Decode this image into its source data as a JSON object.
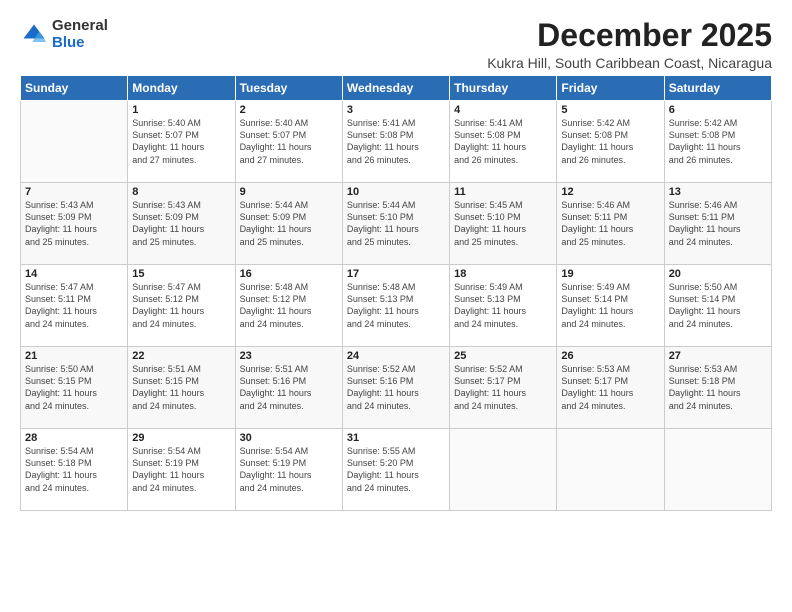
{
  "logo": {
    "general": "General",
    "blue": "Blue"
  },
  "title": "December 2025",
  "subtitle": "Kukra Hill, South Caribbean Coast, Nicaragua",
  "headers": [
    "Sunday",
    "Monday",
    "Tuesday",
    "Wednesday",
    "Thursday",
    "Friday",
    "Saturday"
  ],
  "weeks": [
    [
      {
        "day": "",
        "info": ""
      },
      {
        "day": "1",
        "info": "Sunrise: 5:40 AM\nSunset: 5:07 PM\nDaylight: 11 hours\nand 27 minutes."
      },
      {
        "day": "2",
        "info": "Sunrise: 5:40 AM\nSunset: 5:07 PM\nDaylight: 11 hours\nand 27 minutes."
      },
      {
        "day": "3",
        "info": "Sunrise: 5:41 AM\nSunset: 5:08 PM\nDaylight: 11 hours\nand 26 minutes."
      },
      {
        "day": "4",
        "info": "Sunrise: 5:41 AM\nSunset: 5:08 PM\nDaylight: 11 hours\nand 26 minutes."
      },
      {
        "day": "5",
        "info": "Sunrise: 5:42 AM\nSunset: 5:08 PM\nDaylight: 11 hours\nand 26 minutes."
      },
      {
        "day": "6",
        "info": "Sunrise: 5:42 AM\nSunset: 5:08 PM\nDaylight: 11 hours\nand 26 minutes."
      }
    ],
    [
      {
        "day": "7",
        "info": "Sunrise: 5:43 AM\nSunset: 5:09 PM\nDaylight: 11 hours\nand 25 minutes."
      },
      {
        "day": "8",
        "info": "Sunrise: 5:43 AM\nSunset: 5:09 PM\nDaylight: 11 hours\nand 25 minutes."
      },
      {
        "day": "9",
        "info": "Sunrise: 5:44 AM\nSunset: 5:09 PM\nDaylight: 11 hours\nand 25 minutes."
      },
      {
        "day": "10",
        "info": "Sunrise: 5:44 AM\nSunset: 5:10 PM\nDaylight: 11 hours\nand 25 minutes."
      },
      {
        "day": "11",
        "info": "Sunrise: 5:45 AM\nSunset: 5:10 PM\nDaylight: 11 hours\nand 25 minutes."
      },
      {
        "day": "12",
        "info": "Sunrise: 5:46 AM\nSunset: 5:11 PM\nDaylight: 11 hours\nand 25 minutes."
      },
      {
        "day": "13",
        "info": "Sunrise: 5:46 AM\nSunset: 5:11 PM\nDaylight: 11 hours\nand 24 minutes."
      }
    ],
    [
      {
        "day": "14",
        "info": "Sunrise: 5:47 AM\nSunset: 5:11 PM\nDaylight: 11 hours\nand 24 minutes."
      },
      {
        "day": "15",
        "info": "Sunrise: 5:47 AM\nSunset: 5:12 PM\nDaylight: 11 hours\nand 24 minutes."
      },
      {
        "day": "16",
        "info": "Sunrise: 5:48 AM\nSunset: 5:12 PM\nDaylight: 11 hours\nand 24 minutes."
      },
      {
        "day": "17",
        "info": "Sunrise: 5:48 AM\nSunset: 5:13 PM\nDaylight: 11 hours\nand 24 minutes."
      },
      {
        "day": "18",
        "info": "Sunrise: 5:49 AM\nSunset: 5:13 PM\nDaylight: 11 hours\nand 24 minutes."
      },
      {
        "day": "19",
        "info": "Sunrise: 5:49 AM\nSunset: 5:14 PM\nDaylight: 11 hours\nand 24 minutes."
      },
      {
        "day": "20",
        "info": "Sunrise: 5:50 AM\nSunset: 5:14 PM\nDaylight: 11 hours\nand 24 minutes."
      }
    ],
    [
      {
        "day": "21",
        "info": "Sunrise: 5:50 AM\nSunset: 5:15 PM\nDaylight: 11 hours\nand 24 minutes."
      },
      {
        "day": "22",
        "info": "Sunrise: 5:51 AM\nSunset: 5:15 PM\nDaylight: 11 hours\nand 24 minutes."
      },
      {
        "day": "23",
        "info": "Sunrise: 5:51 AM\nSunset: 5:16 PM\nDaylight: 11 hours\nand 24 minutes."
      },
      {
        "day": "24",
        "info": "Sunrise: 5:52 AM\nSunset: 5:16 PM\nDaylight: 11 hours\nand 24 minutes."
      },
      {
        "day": "25",
        "info": "Sunrise: 5:52 AM\nSunset: 5:17 PM\nDaylight: 11 hours\nand 24 minutes."
      },
      {
        "day": "26",
        "info": "Sunrise: 5:53 AM\nSunset: 5:17 PM\nDaylight: 11 hours\nand 24 minutes."
      },
      {
        "day": "27",
        "info": "Sunrise: 5:53 AM\nSunset: 5:18 PM\nDaylight: 11 hours\nand 24 minutes."
      }
    ],
    [
      {
        "day": "28",
        "info": "Sunrise: 5:54 AM\nSunset: 5:18 PM\nDaylight: 11 hours\nand 24 minutes."
      },
      {
        "day": "29",
        "info": "Sunrise: 5:54 AM\nSunset: 5:19 PM\nDaylight: 11 hours\nand 24 minutes."
      },
      {
        "day": "30",
        "info": "Sunrise: 5:54 AM\nSunset: 5:19 PM\nDaylight: 11 hours\nand 24 minutes."
      },
      {
        "day": "31",
        "info": "Sunrise: 5:55 AM\nSunset: 5:20 PM\nDaylight: 11 hours\nand 24 minutes."
      },
      {
        "day": "",
        "info": ""
      },
      {
        "day": "",
        "info": ""
      },
      {
        "day": "",
        "info": ""
      }
    ]
  ]
}
